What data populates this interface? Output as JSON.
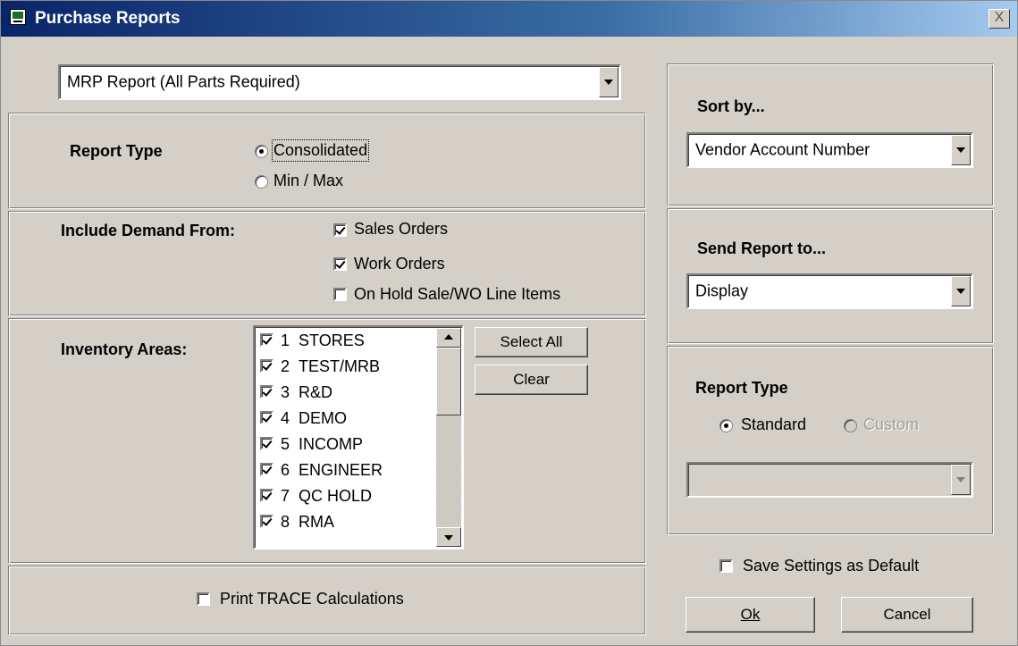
{
  "window": {
    "title": "Purchase Reports",
    "close_label": "X"
  },
  "report_select": {
    "value": "MRP Report (All Parts Required)"
  },
  "report_type": {
    "label": "Report Type",
    "options": [
      {
        "label": "Consolidated",
        "selected": true
      },
      {
        "label": "Min / Max",
        "selected": false
      }
    ]
  },
  "demand": {
    "label": "Include Demand From:",
    "options": [
      {
        "label": "Sales Orders",
        "checked": true
      },
      {
        "label": "Work Orders",
        "checked": true
      },
      {
        "label": "On Hold Sale/WO Line Items",
        "checked": false
      }
    ]
  },
  "inventory": {
    "label": "Inventory Areas:",
    "items": [
      {
        "num": "1",
        "name": "STORES",
        "checked": true
      },
      {
        "num": "2",
        "name": "TEST/MRB",
        "checked": true
      },
      {
        "num": "3",
        "name": "R&D",
        "checked": true
      },
      {
        "num": "4",
        "name": "DEMO",
        "checked": true
      },
      {
        "num": "5",
        "name": "INCOMP",
        "checked": true
      },
      {
        "num": "6",
        "name": "ENGINEER",
        "checked": true
      },
      {
        "num": "7",
        "name": "QC HOLD",
        "checked": true
      },
      {
        "num": "8",
        "name": "RMA",
        "checked": true
      }
    ],
    "select_all_label": "Select All",
    "clear_label": "Clear"
  },
  "trace": {
    "label": "Print TRACE Calculations",
    "checked": false
  },
  "sort": {
    "label": "Sort by...",
    "value": "Vendor Account Number"
  },
  "send": {
    "label": "Send Report to...",
    "value": "Display"
  },
  "right_report_type": {
    "label": "Report Type",
    "standard_label": "Standard",
    "custom_label": "Custom",
    "selected": "Standard",
    "custom_value": ""
  },
  "save_default": {
    "label": "Save Settings as Default",
    "checked": false
  },
  "ok_label": "Ok",
  "cancel_label": "Cancel"
}
